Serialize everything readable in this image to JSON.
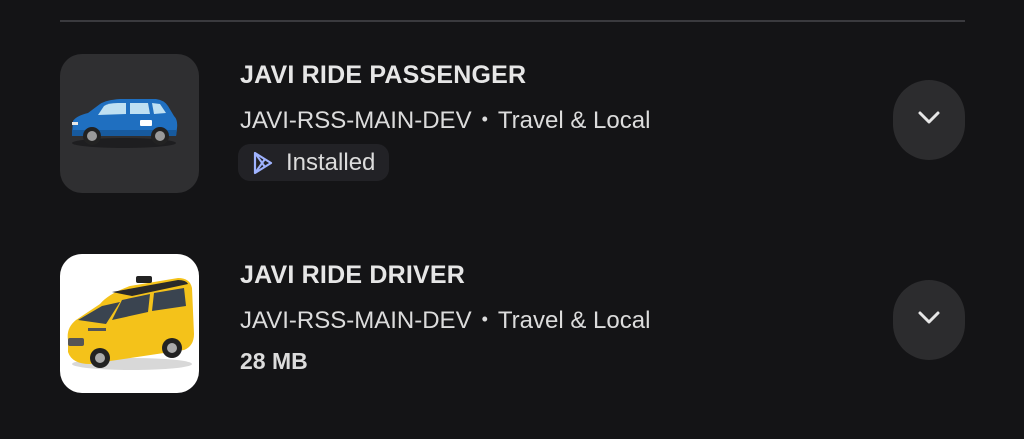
{
  "apps": [
    {
      "title": "JAVI RIDE PASSENGER",
      "developer": "JAVI-RSS-MAIN-DEV",
      "separator": "•",
      "category": "Travel & Local",
      "status": "Installed",
      "status_icon": "play-store-icon",
      "icon": "blue-hatchback-car-icon",
      "expand_icon": "chevron-down-icon"
    },
    {
      "title": "JAVI RIDE DRIVER",
      "developer": "JAVI-RSS-MAIN-DEV",
      "separator": "•",
      "category": "Travel & Local",
      "size": "28 MB",
      "icon": "yellow-taxi-van-icon",
      "expand_icon": "chevron-down-icon"
    }
  ],
  "colors": {
    "background": "#141416",
    "icon_tile_dark": "#2f2f31",
    "badge_bg": "#222226",
    "button_bg": "#2c2c2e",
    "play_icon": "#9fb3ff"
  }
}
